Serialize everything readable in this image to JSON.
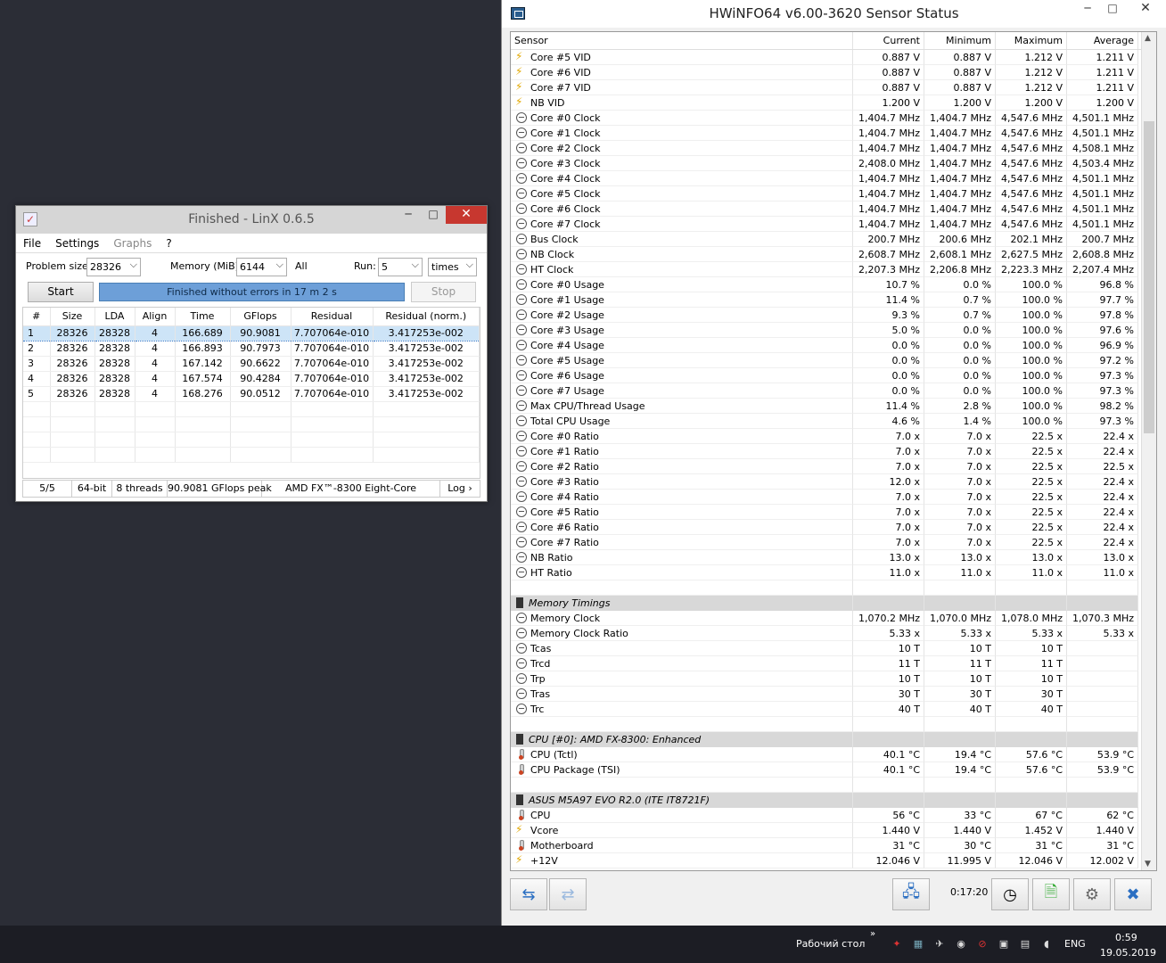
{
  "linx": {
    "title": "Finished - LinX 0.6.5",
    "menu": [
      "File",
      "Settings",
      "Graphs",
      "?"
    ],
    "problem_size_label": "Problem size:",
    "problem_size": "28326",
    "memory_label": "Memory (MiB):",
    "memory": "6144",
    "all_label": "All",
    "run_label": "Run:",
    "run": "5",
    "run_unit": "times",
    "start": "Start",
    "progress_text": "Finished without errors in 17 m 2 s",
    "stop": "Stop",
    "columns": [
      "#",
      "Size",
      "LDA",
      "Align",
      "Time",
      "GFlops",
      "Residual",
      "Residual (norm.)"
    ],
    "rows": [
      [
        "1",
        "28326",
        "28328",
        "4",
        "166.689",
        "90.9081",
        "7.707064e-010",
        "3.417253e-002"
      ],
      [
        "2",
        "28326",
        "28328",
        "4",
        "166.893",
        "90.7973",
        "7.707064e-010",
        "3.417253e-002"
      ],
      [
        "3",
        "28326",
        "28328",
        "4",
        "167.142",
        "90.6622",
        "7.707064e-010",
        "3.417253e-002"
      ],
      [
        "4",
        "28326",
        "28328",
        "4",
        "167.574",
        "90.4284",
        "7.707064e-010",
        "3.417253e-002"
      ],
      [
        "5",
        "28326",
        "28328",
        "4",
        "168.276",
        "90.0512",
        "7.707064e-010",
        "3.417253e-002"
      ]
    ],
    "status": [
      "5/5",
      "64-bit",
      "8 threads",
      "90.9081 GFlops peak",
      "AMD FX™-8300 Eight-Core",
      "Log ›"
    ]
  },
  "hwinfo": {
    "title": "HWiNFO64 v6.00-3620 Sensor Status",
    "columns": [
      "Sensor",
      "Current",
      "Minimum",
      "Maximum",
      "Average"
    ],
    "rows": [
      {
        "t": "r",
        "i": "volt",
        "n": "Core #5 VID",
        "v": [
          "0.887 V",
          "0.887 V",
          "1.212 V",
          "1.211 V"
        ]
      },
      {
        "t": "r",
        "i": "volt",
        "n": "Core #6 VID",
        "v": [
          "0.887 V",
          "0.887 V",
          "1.212 V",
          "1.211 V"
        ]
      },
      {
        "t": "r",
        "i": "volt",
        "n": "Core #7 VID",
        "v": [
          "0.887 V",
          "0.887 V",
          "1.212 V",
          "1.211 V"
        ]
      },
      {
        "t": "r",
        "i": "volt",
        "n": "NB VID",
        "v": [
          "1.200 V",
          "1.200 V",
          "1.200 V",
          "1.200 V"
        ]
      },
      {
        "t": "r",
        "i": "clock",
        "n": "Core #0 Clock",
        "v": [
          "1,404.7 MHz",
          "1,404.7 MHz",
          "4,547.6 MHz",
          "4,501.1 MHz"
        ]
      },
      {
        "t": "r",
        "i": "clock",
        "n": "Core #1 Clock",
        "v": [
          "1,404.7 MHz",
          "1,404.7 MHz",
          "4,547.6 MHz",
          "4,501.1 MHz"
        ]
      },
      {
        "t": "r",
        "i": "clock",
        "n": "Core #2 Clock",
        "v": [
          "1,404.7 MHz",
          "1,404.7 MHz",
          "4,547.6 MHz",
          "4,508.1 MHz"
        ]
      },
      {
        "t": "r",
        "i": "clock",
        "n": "Core #3 Clock",
        "v": [
          "2,408.0 MHz",
          "1,404.7 MHz",
          "4,547.6 MHz",
          "4,503.4 MHz"
        ]
      },
      {
        "t": "r",
        "i": "clock",
        "n": "Core #4 Clock",
        "v": [
          "1,404.7 MHz",
          "1,404.7 MHz",
          "4,547.6 MHz",
          "4,501.1 MHz"
        ]
      },
      {
        "t": "r",
        "i": "clock",
        "n": "Core #5 Clock",
        "v": [
          "1,404.7 MHz",
          "1,404.7 MHz",
          "4,547.6 MHz",
          "4,501.1 MHz"
        ]
      },
      {
        "t": "r",
        "i": "clock",
        "n": "Core #6 Clock",
        "v": [
          "1,404.7 MHz",
          "1,404.7 MHz",
          "4,547.6 MHz",
          "4,501.1 MHz"
        ]
      },
      {
        "t": "r",
        "i": "clock",
        "n": "Core #7 Clock",
        "v": [
          "1,404.7 MHz",
          "1,404.7 MHz",
          "4,547.6 MHz",
          "4,501.1 MHz"
        ]
      },
      {
        "t": "r",
        "i": "clock",
        "n": "Bus Clock",
        "v": [
          "200.7 MHz",
          "200.6 MHz",
          "202.1 MHz",
          "200.7 MHz"
        ]
      },
      {
        "t": "r",
        "i": "clock",
        "n": "NB Clock",
        "v": [
          "2,608.7 MHz",
          "2,608.1 MHz",
          "2,627.5 MHz",
          "2,608.8 MHz"
        ]
      },
      {
        "t": "r",
        "i": "clock",
        "n": "HT Clock",
        "v": [
          "2,207.3 MHz",
          "2,206.8 MHz",
          "2,223.3 MHz",
          "2,207.4 MHz"
        ]
      },
      {
        "t": "r",
        "i": "clock",
        "n": "Core #0 Usage",
        "v": [
          "10.7 %",
          "0.0 %",
          "100.0 %",
          "96.8 %"
        ]
      },
      {
        "t": "r",
        "i": "clock",
        "n": "Core #1 Usage",
        "v": [
          "11.4 %",
          "0.7 %",
          "100.0 %",
          "97.7 %"
        ]
      },
      {
        "t": "r",
        "i": "clock",
        "n": "Core #2 Usage",
        "v": [
          "9.3 %",
          "0.7 %",
          "100.0 %",
          "97.8 %"
        ]
      },
      {
        "t": "r",
        "i": "clock",
        "n": "Core #3 Usage",
        "v": [
          "5.0 %",
          "0.0 %",
          "100.0 %",
          "97.6 %"
        ]
      },
      {
        "t": "r",
        "i": "clock",
        "n": "Core #4 Usage",
        "v": [
          "0.0 %",
          "0.0 %",
          "100.0 %",
          "96.9 %"
        ]
      },
      {
        "t": "r",
        "i": "clock",
        "n": "Core #5 Usage",
        "v": [
          "0.0 %",
          "0.0 %",
          "100.0 %",
          "97.2 %"
        ]
      },
      {
        "t": "r",
        "i": "clock",
        "n": "Core #6 Usage",
        "v": [
          "0.0 %",
          "0.0 %",
          "100.0 %",
          "97.3 %"
        ]
      },
      {
        "t": "r",
        "i": "clock",
        "n": "Core #7 Usage",
        "v": [
          "0.0 %",
          "0.0 %",
          "100.0 %",
          "97.3 %"
        ]
      },
      {
        "t": "r",
        "i": "clock",
        "n": "Max CPU/Thread Usage",
        "v": [
          "11.4 %",
          "2.8 %",
          "100.0 %",
          "98.2 %"
        ]
      },
      {
        "t": "r",
        "i": "clock",
        "n": "Total CPU Usage",
        "v": [
          "4.6 %",
          "1.4 %",
          "100.0 %",
          "97.3 %"
        ]
      },
      {
        "t": "r",
        "i": "clock",
        "n": "Core #0 Ratio",
        "v": [
          "7.0 x",
          "7.0 x",
          "22.5 x",
          "22.4 x"
        ]
      },
      {
        "t": "r",
        "i": "clock",
        "n": "Core #1 Ratio",
        "v": [
          "7.0 x",
          "7.0 x",
          "22.5 x",
          "22.4 x"
        ]
      },
      {
        "t": "r",
        "i": "clock",
        "n": "Core #2 Ratio",
        "v": [
          "7.0 x",
          "7.0 x",
          "22.5 x",
          "22.5 x"
        ]
      },
      {
        "t": "r",
        "i": "clock",
        "n": "Core #3 Ratio",
        "v": [
          "12.0 x",
          "7.0 x",
          "22.5 x",
          "22.4 x"
        ]
      },
      {
        "t": "r",
        "i": "clock",
        "n": "Core #4 Ratio",
        "v": [
          "7.0 x",
          "7.0 x",
          "22.5 x",
          "22.4 x"
        ]
      },
      {
        "t": "r",
        "i": "clock",
        "n": "Core #5 Ratio",
        "v": [
          "7.0 x",
          "7.0 x",
          "22.5 x",
          "22.4 x"
        ]
      },
      {
        "t": "r",
        "i": "clock",
        "n": "Core #6 Ratio",
        "v": [
          "7.0 x",
          "7.0 x",
          "22.5 x",
          "22.4 x"
        ]
      },
      {
        "t": "r",
        "i": "clock",
        "n": "Core #7 Ratio",
        "v": [
          "7.0 x",
          "7.0 x",
          "22.5 x",
          "22.4 x"
        ]
      },
      {
        "t": "r",
        "i": "clock",
        "n": "NB Ratio",
        "v": [
          "13.0 x",
          "13.0 x",
          "13.0 x",
          "13.0 x"
        ]
      },
      {
        "t": "r",
        "i": "clock",
        "n": "HT Ratio",
        "v": [
          "11.0 x",
          "11.0 x",
          "11.0 x",
          "11.0 x"
        ]
      },
      {
        "t": "b"
      },
      {
        "t": "g",
        "n": "Memory Timings"
      },
      {
        "t": "r",
        "i": "clock",
        "n": "Memory Clock",
        "v": [
          "1,070.2 MHz",
          "1,070.0 MHz",
          "1,078.0 MHz",
          "1,070.3 MHz"
        ]
      },
      {
        "t": "r",
        "i": "clock",
        "n": "Memory Clock Ratio",
        "v": [
          "5.33 x",
          "5.33 x",
          "5.33 x",
          "5.33 x"
        ]
      },
      {
        "t": "r",
        "i": "clock",
        "n": "Tcas",
        "v": [
          "10 T",
          "10 T",
          "10 T",
          ""
        ]
      },
      {
        "t": "r",
        "i": "clock",
        "n": "Trcd",
        "v": [
          "11 T",
          "11 T",
          "11 T",
          ""
        ]
      },
      {
        "t": "r",
        "i": "clock",
        "n": "Trp",
        "v": [
          "10 T",
          "10 T",
          "10 T",
          ""
        ]
      },
      {
        "t": "r",
        "i": "clock",
        "n": "Tras",
        "v": [
          "30 T",
          "30 T",
          "30 T",
          ""
        ]
      },
      {
        "t": "r",
        "i": "clock",
        "n": "Trc",
        "v": [
          "40 T",
          "40 T",
          "40 T",
          ""
        ]
      },
      {
        "t": "b"
      },
      {
        "t": "g",
        "n": "CPU [#0]: AMD FX-8300: Enhanced"
      },
      {
        "t": "r",
        "i": "temp",
        "n": "CPU (Tctl)",
        "v": [
          "40.1 °C",
          "19.4 °C",
          "57.6 °C",
          "53.9 °C"
        ]
      },
      {
        "t": "r",
        "i": "temp",
        "n": "CPU Package (TSI)",
        "v": [
          "40.1 °C",
          "19.4 °C",
          "57.6 °C",
          "53.9 °C"
        ]
      },
      {
        "t": "b"
      },
      {
        "t": "g",
        "n": "ASUS M5A97 EVO R2.0 (ITE IT8721F)"
      },
      {
        "t": "r",
        "i": "temp",
        "n": "CPU",
        "v": [
          "56 °C",
          "33 °C",
          "67 °C",
          "62 °C"
        ]
      },
      {
        "t": "r",
        "i": "volt",
        "n": "Vcore",
        "v": [
          "1.440 V",
          "1.440 V",
          "1.452 V",
          "1.440 V"
        ]
      },
      {
        "t": "r",
        "i": "temp",
        "n": "Motherboard",
        "v": [
          "31 °C",
          "30 °C",
          "31 °C",
          "31 °C"
        ]
      },
      {
        "t": "r",
        "i": "volt",
        "n": "+12V",
        "v": [
          "12.046 V",
          "11.995 V",
          "12.046 V",
          "12.002 V"
        ]
      }
    ],
    "timer": "0:17:20"
  },
  "taskbar": {
    "desktop_label": "Рабочий стол",
    "lang": "ENG",
    "time": "0:59",
    "date": "19.05.2019"
  }
}
